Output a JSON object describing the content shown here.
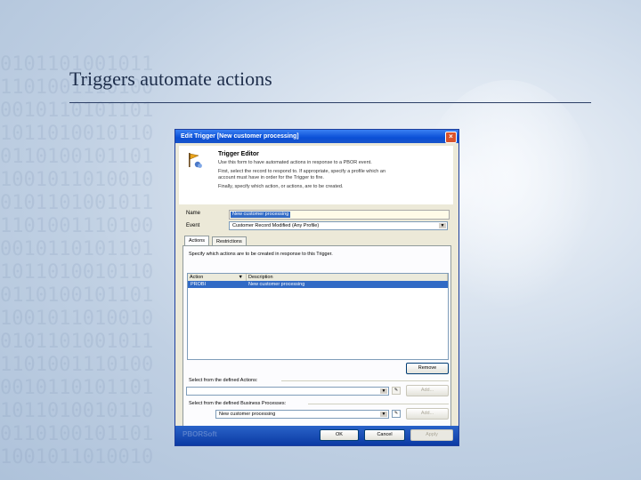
{
  "slide": {
    "title": "Triggers automate actions"
  },
  "dialog": {
    "title": "Edit Trigger [New customer processing]",
    "close_glyph": "×",
    "header": {
      "title": "Trigger Editor",
      "lines": [
        "Use this form to have automated actions in response to a PBOR event.",
        "First, select the record to respond to. If appropriate, specify a profile which an",
        "account must have in order for the Trigger to fire.",
        "Finally, specify which action, or actions, are to be created."
      ]
    },
    "name_label": "Name",
    "name_value": "New customer processing",
    "event_label": "Event",
    "event_value": "Customer Record Modified (Any Profile)",
    "tabs": [
      "Actions",
      "Restrictions"
    ],
    "actions_tab": {
      "instructions": "Specify which actions are to be created in response to this Trigger.",
      "columns": [
        "Action",
        "Description"
      ],
      "rows": [
        {
          "action": "PROBI",
          "description": "New customer processing"
        }
      ],
      "remove_label": "Remove",
      "defined_actions_label": "Select from the defined Actions:",
      "defined_actions_value": "",
      "defined_processes_label": "Select from the defined Business Processes:",
      "defined_processes_value": "New customer processing",
      "add_label": "Add..."
    },
    "buttons": {
      "ok": "OK",
      "cancel": "Cancel",
      "apply": "Apply"
    },
    "footer_logo": "PBORSoft"
  }
}
